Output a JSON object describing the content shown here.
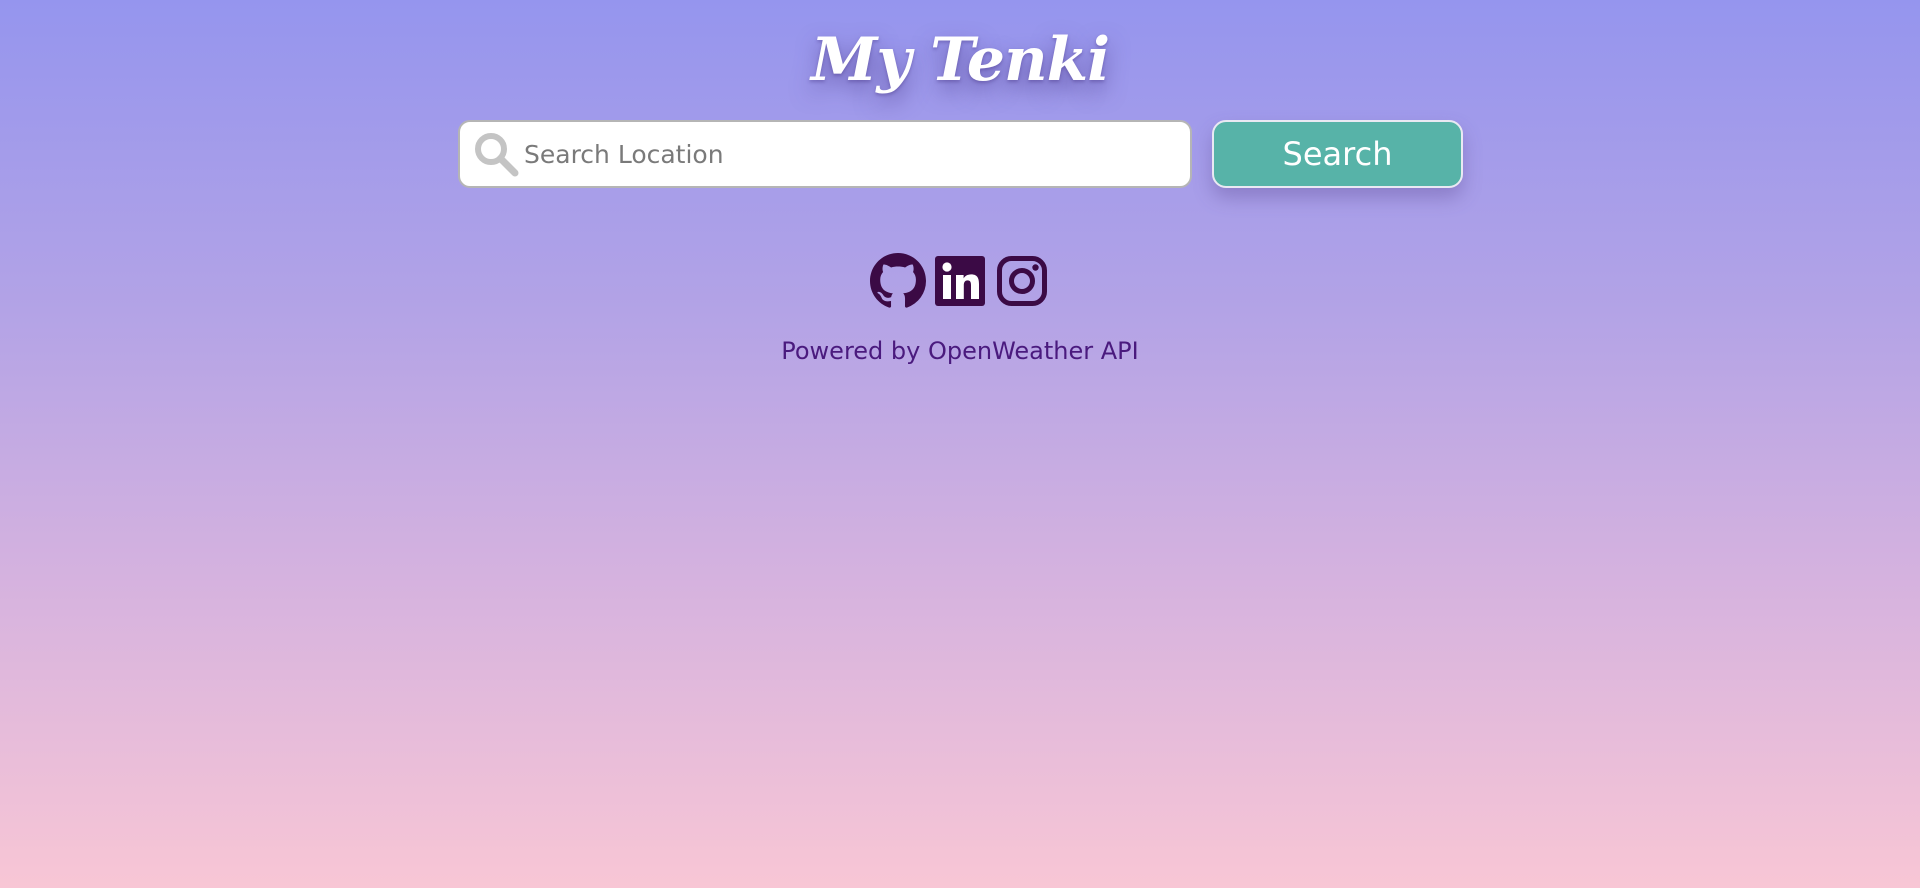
{
  "app": {
    "title": "My Tenki"
  },
  "search": {
    "placeholder": "Search Location",
    "value": "",
    "button_label": "Search",
    "icon": "search-icon"
  },
  "social": {
    "links": [
      {
        "name": "GitHub",
        "icon": "github-icon"
      },
      {
        "name": "LinkedIn",
        "icon": "linkedin-icon"
      },
      {
        "name": "Instagram",
        "icon": "instagram-icon"
      }
    ]
  },
  "footer": {
    "text": "Powered by OpenWeather API"
  },
  "colors": {
    "icon": "#3b0a45",
    "button": "#57b3a8",
    "footer_text": "#4a1a7e",
    "gradient_top": "#9595ee",
    "gradient_bottom": "#f8c6d5"
  }
}
